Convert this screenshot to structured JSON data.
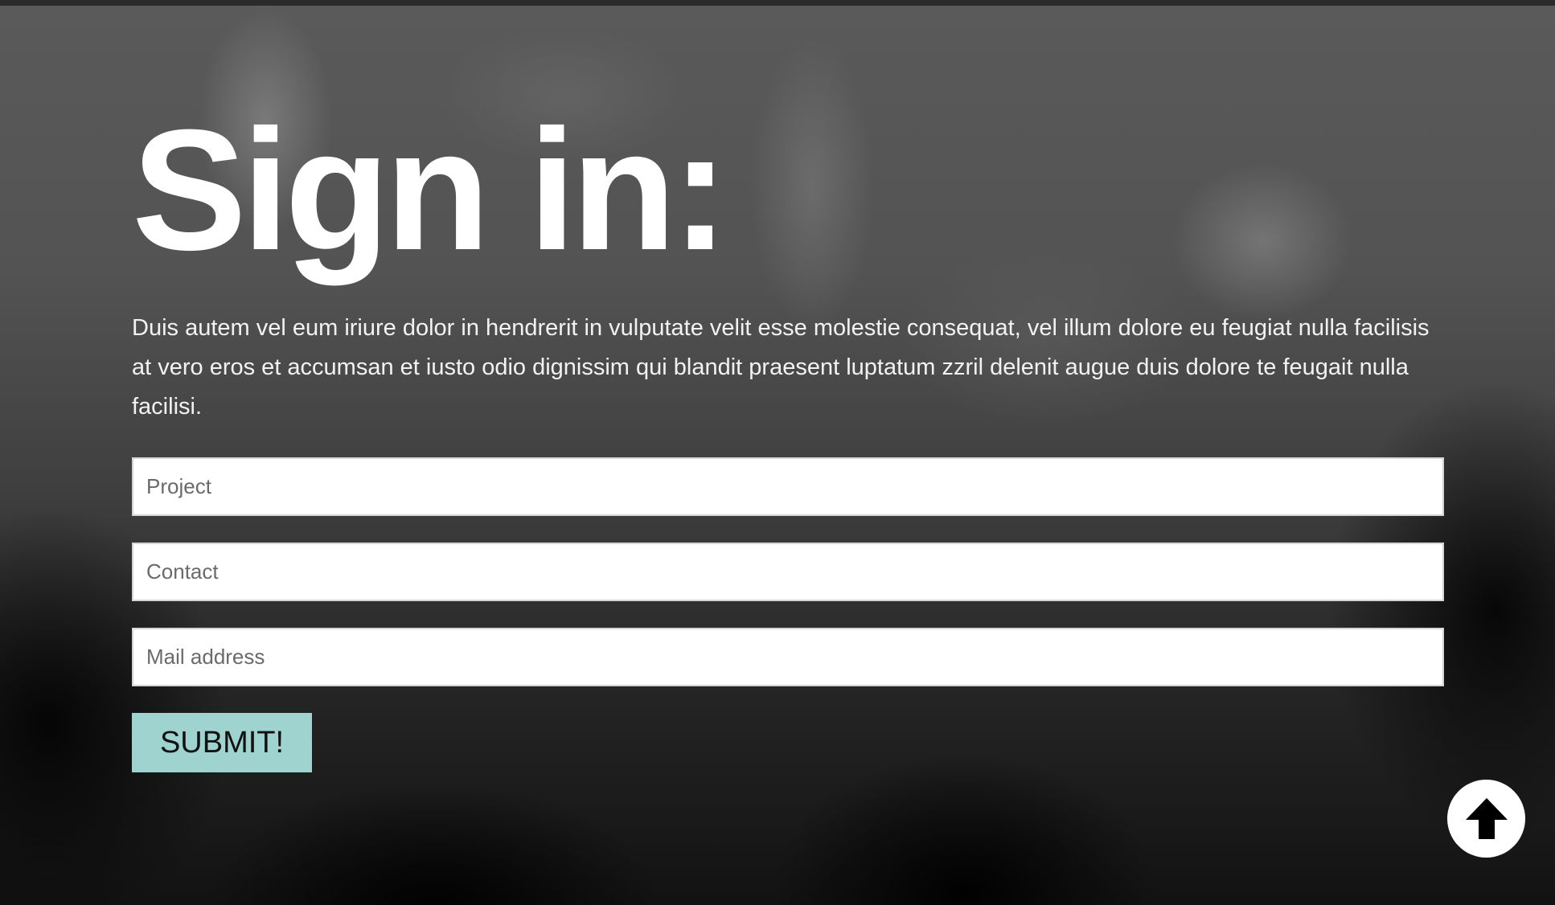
{
  "signin": {
    "title": "Sign in:",
    "description": "Duis autem vel eum iriure dolor in hendrerit in vulputate velit esse molestie consequat, vel illum dolore eu feugiat nulla facilisis at vero eros et accumsan et iusto odio dignissim qui blandit praesent luptatum zzril delenit augue duis dolore te feugait nulla facilisi.",
    "fields": {
      "project_placeholder": "Project",
      "contact_placeholder": "Contact",
      "mail_placeholder": "Mail address"
    },
    "submit_label": "SUBMIT!"
  },
  "scroll_top": {
    "icon": "arrow-up-icon"
  },
  "colors": {
    "submit_bg": "#9ed3cf",
    "title": "#ffffff",
    "field_bg": "#ffffff"
  }
}
